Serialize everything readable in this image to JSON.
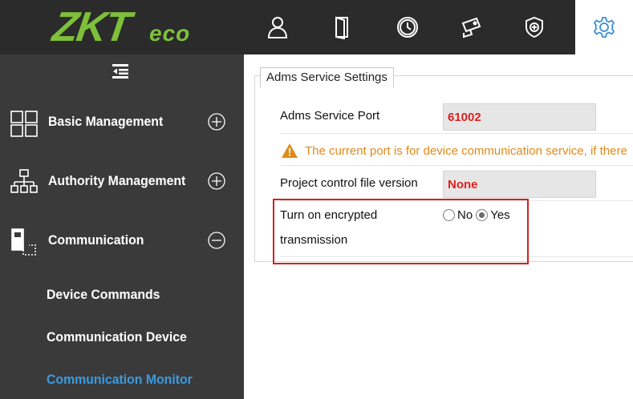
{
  "logo": {
    "main": "ZKT",
    "suffix": "eco"
  },
  "topnav": {
    "icons": [
      "person-icon",
      "door-icon",
      "clock-icon",
      "camera-icon",
      "shield-icon",
      "gear-icon"
    ]
  },
  "sidebar": {
    "items": [
      {
        "label": "Basic Management",
        "icon": "grid-icon",
        "state": "collapsed"
      },
      {
        "label": "Authority Management",
        "icon": "org-chart-icon",
        "state": "collapsed"
      },
      {
        "label": "Communication",
        "icon": "device-icon",
        "state": "expanded"
      }
    ],
    "submenu": [
      {
        "label": "Device Commands"
      },
      {
        "label": "Communication Device"
      },
      {
        "label": "Communication Monitor",
        "active": true
      }
    ]
  },
  "settings": {
    "legend": "Adms Service Settings",
    "port_label": "Adms Service Port",
    "port_value": "61002",
    "warning": "The current port is for device communication service, if there",
    "version_label": "Project control file version",
    "version_value": "None",
    "encrypt_label_line1": "Turn on encrypted",
    "encrypt_label_line2": "transmission",
    "encrypt_options": [
      {
        "label": "No",
        "checked": false
      },
      {
        "label": "Yes",
        "checked": true
      }
    ]
  },
  "colors": {
    "topbar_bg": "#2b2b2b",
    "sidebar_bg": "#3a3a3a",
    "logo_green": "#7ec03a",
    "active_link": "#3a9be0",
    "value_red": "#e02020",
    "warning_orange": "#e08a1a",
    "highlight_red": "#d42020"
  }
}
